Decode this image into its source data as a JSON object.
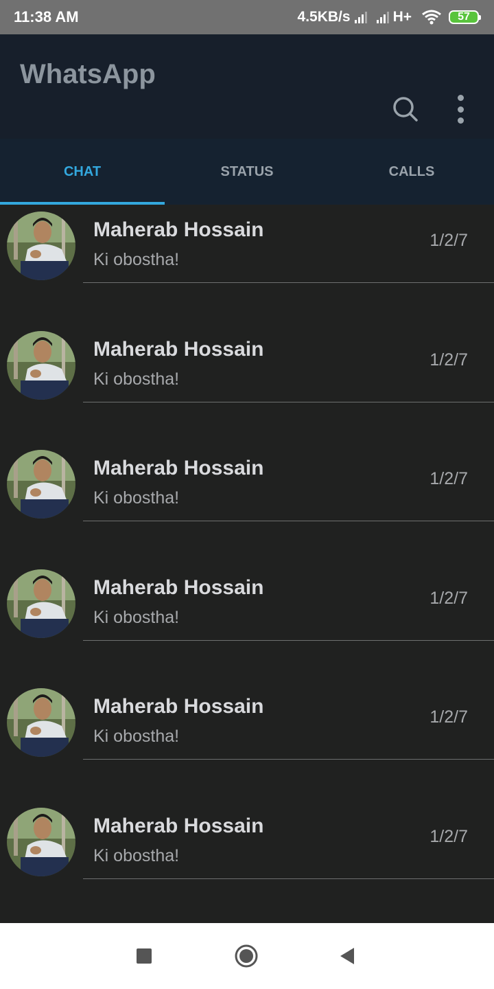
{
  "status_bar": {
    "time": "11:38 AM",
    "speed": "4.5KB/s",
    "network_type": "H+",
    "battery": "57",
    "battery_color": "#59c43d"
  },
  "app": {
    "title": "WhatsApp",
    "actions": [
      "search-icon",
      "more-vert-icon"
    ]
  },
  "tabs": [
    {
      "label": "CHAT",
      "active": true
    },
    {
      "label": "STATUS",
      "active": false
    },
    {
      "label": "CALLS",
      "active": false
    }
  ],
  "accent_color": "#33a8de",
  "chats": [
    {
      "name": "Maherab Hossain",
      "message": "Ki obostha!",
      "date": "1/2/7"
    },
    {
      "name": "Maherab Hossain",
      "message": "Ki obostha!",
      "date": "1/2/7"
    },
    {
      "name": "Maherab Hossain",
      "message": "Ki obostha!",
      "date": "1/2/7"
    },
    {
      "name": "Maherab Hossain",
      "message": "Ki obostha!",
      "date": "1/2/7"
    },
    {
      "name": "Maherab Hossain",
      "message": "Ki obostha!",
      "date": "1/2/7"
    },
    {
      "name": "Maherab Hossain",
      "message": "Ki obostha!",
      "date": "1/2/7"
    }
  ],
  "nav_bar": [
    "recents-icon",
    "home-icon",
    "back-icon"
  ]
}
